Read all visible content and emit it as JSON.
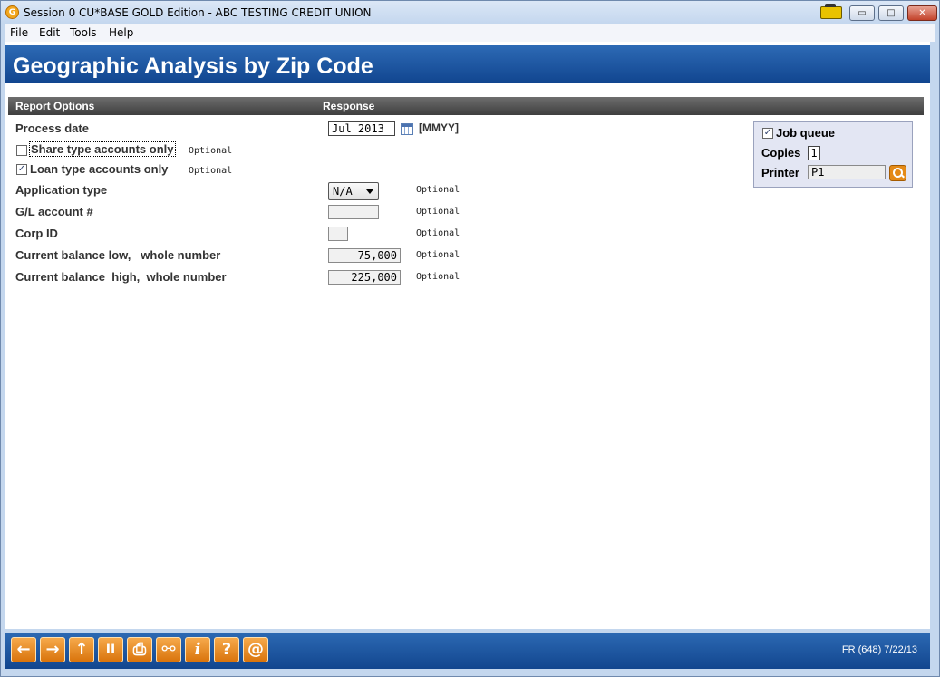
{
  "window": {
    "title": "Session 0 CU*BASE GOLD Edition - ABC TESTING CREDIT UNION",
    "app_icon_glyph": "G",
    "minimize_glyph": "▭",
    "maximize_glyph": "□",
    "close_glyph": "✕"
  },
  "menu": [
    "File",
    "Edit",
    "Tools",
    "Help"
  ],
  "page": {
    "title": "Geographic Analysis by Zip Code"
  },
  "section": {
    "col1": "Report Options",
    "col2": "Response"
  },
  "form": {
    "process_date": {
      "label": "Process date",
      "value": "Jul 2013",
      "format": "[MMYY]"
    },
    "share_only": {
      "label": "Share type accounts only",
      "checked": false,
      "hint": "Optional"
    },
    "loan_only": {
      "label": "Loan type accounts only",
      "checked": true,
      "hint": "Optional",
      "check_glyph": "✓"
    },
    "application_type": {
      "label": "Application type",
      "value": "N/A",
      "hint": "Optional"
    },
    "gl_account": {
      "label": "G/L account #",
      "value": "",
      "hint": "Optional"
    },
    "corp_id": {
      "label": "Corp ID",
      "value": "",
      "hint": "Optional"
    },
    "balance_low": {
      "label": "Current balance low,   whole number",
      "value": "75,000",
      "hint": "Optional"
    },
    "balance_high": {
      "label": "Current balance  high,  whole number",
      "value": "225,000",
      "hint": "Optional"
    }
  },
  "job": {
    "job_queue_label": "Job queue",
    "job_queue_checked": true,
    "check_glyph": "✓",
    "copies_label": "Copies",
    "copies_value": "1",
    "printer_label": "Printer",
    "printer_value": "P1"
  },
  "footer": {
    "buttons": [
      {
        "name": "back-button",
        "glyph": "←"
      },
      {
        "name": "forward-button",
        "glyph": "→"
      },
      {
        "name": "up-button",
        "glyph": "↑"
      },
      {
        "name": "pause-button",
        "glyph": "II"
      },
      {
        "name": "print-button",
        "glyph": "⎙"
      },
      {
        "name": "link-button",
        "glyph": "⚯"
      },
      {
        "name": "info-button",
        "glyph": "i"
      },
      {
        "name": "help-button",
        "glyph": "?"
      },
      {
        "name": "email-button",
        "glyph": "@"
      }
    ],
    "status": "FR (648) 7/22/13"
  },
  "colors": {
    "header_blue": "#1d5aa6",
    "section_gray": "#4a4a4a",
    "footer_orange": "#e8891a"
  }
}
